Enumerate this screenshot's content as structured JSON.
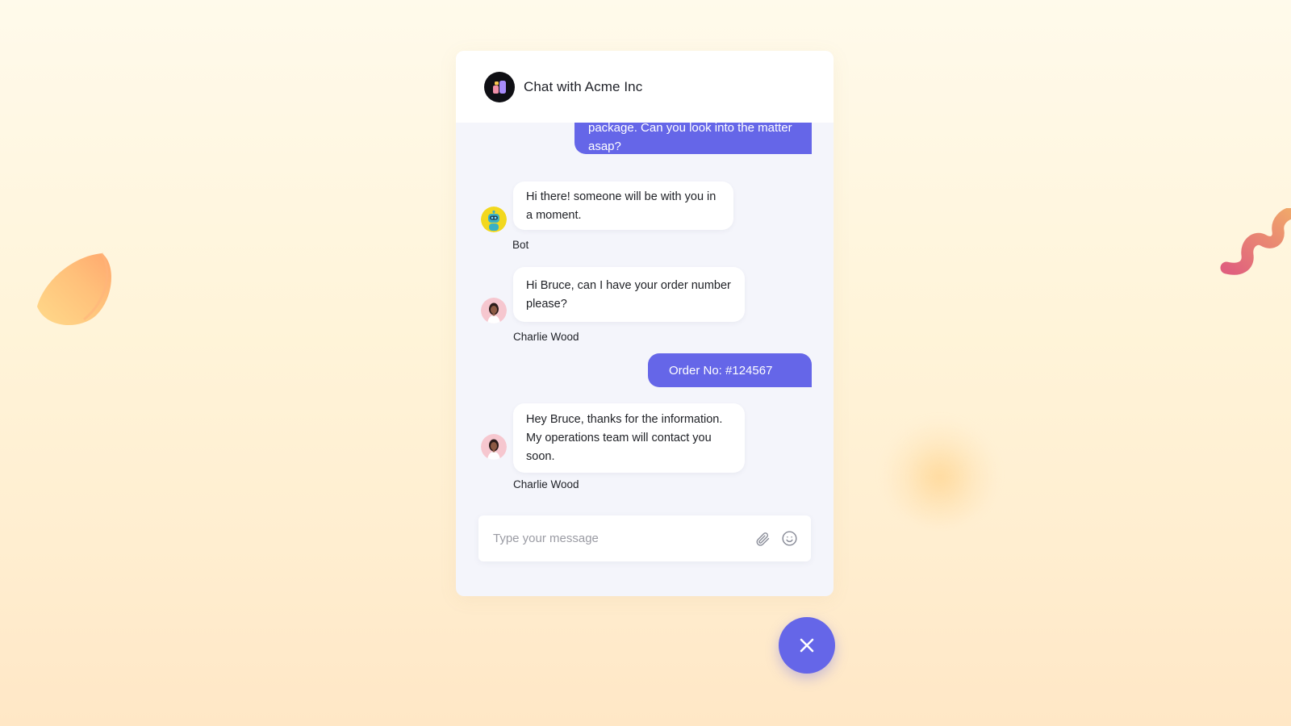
{
  "header": {
    "title": "Chat with Acme Inc",
    "logo_icon": "brand-logo-icon"
  },
  "messages": [
    {
      "type": "user",
      "text": "package. Can you look into the matter asap?"
    },
    {
      "type": "agent",
      "text": "Hi there! someone will be with you in a moment.",
      "sender": "Bot",
      "avatar": "bot-avatar"
    },
    {
      "type": "agent",
      "text": "Hi Bruce, can I have your order number please?",
      "sender": "Charlie Wood",
      "avatar": "agent-avatar"
    },
    {
      "type": "user",
      "text": "Order No: #124567"
    },
    {
      "type": "agent",
      "text": "Hey Bruce, thanks for the information. My operations team will contact you soon.",
      "sender": "Charlie Wood",
      "avatar": "agent-avatar"
    }
  ],
  "composer": {
    "placeholder": "Type your message",
    "value": ""
  },
  "colors": {
    "accent": "#6566e8",
    "panel": "#f4f5fb",
    "background": "#fff4d9"
  },
  "icons": {
    "attach": "paperclip-icon",
    "emoji": "smiley-icon",
    "close": "close-icon"
  }
}
